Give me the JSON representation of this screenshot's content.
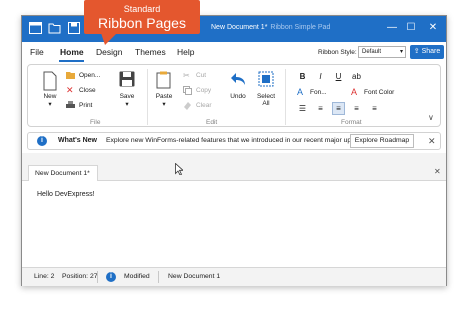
{
  "callout": {
    "line1": "Standard",
    "line2": "Ribbon Pages"
  },
  "window": {
    "title": "New Document 1*",
    "subtitle": "Ribbon Simple Pad"
  },
  "title_controls": {
    "minimize": "—",
    "maximize": "☐",
    "close": "✕"
  },
  "tabs": [
    {
      "label": "File"
    },
    {
      "label": "Home"
    },
    {
      "label": "Design"
    },
    {
      "label": "Themes"
    },
    {
      "label": "Help"
    }
  ],
  "ribbon_style": {
    "label": "Ribbon Style:",
    "value": "Default"
  },
  "share": {
    "label": "Share"
  },
  "groups": {
    "file": {
      "label": "File",
      "new": "New",
      "open": "Open...",
      "close": "Close",
      "print": "Print",
      "save": "Save"
    },
    "edit": {
      "label": "Edit",
      "paste": "Paste",
      "cut": "Cut",
      "copy": "Copy",
      "clear": "Clear",
      "undo": "Undo",
      "select_all_1": "Select",
      "select_all_2": "All"
    },
    "format": {
      "label": "Format",
      "bold": "B",
      "italic": "I",
      "underline": "U",
      "font": "Fon...",
      "font_color": "Font Color"
    }
  },
  "infobar": {
    "title": "What's New",
    "text": "Explore new WinForms-related features that we introduced in our recent major update.",
    "button": "Explore Roadmap",
    "close": "✕"
  },
  "document": {
    "tab": "New Document 1*",
    "tab_close": "✕",
    "content": "Hello DevExpress!"
  },
  "status": {
    "line": "Line: 2",
    "position": "Position: 27",
    "state": "Modified",
    "doc": "New Document 1"
  },
  "colors": {
    "accent": "#1f6fc6",
    "callout": "#e4572e"
  }
}
